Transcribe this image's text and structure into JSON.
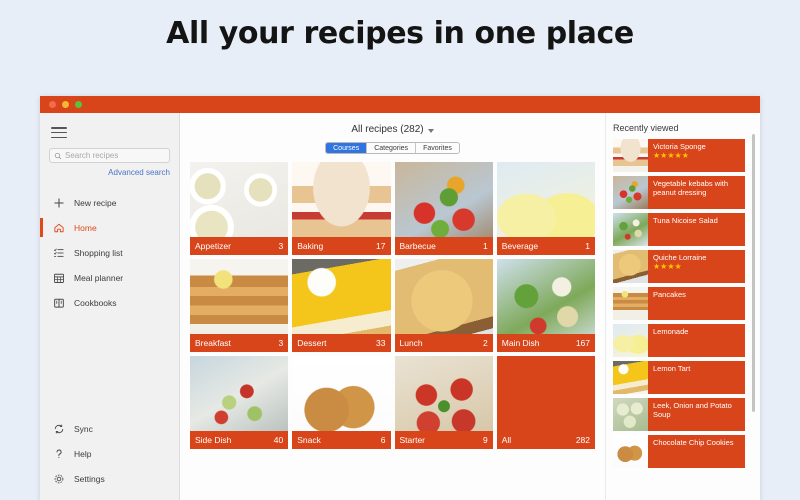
{
  "headline": "All your recipes in one place",
  "window": {
    "traffic_lights": [
      "close",
      "minimize",
      "maximize"
    ]
  },
  "sidebar": {
    "menu_icon": "hamburger-icon",
    "search": {
      "placeholder": "Search recipes",
      "value": "",
      "icon": "search-icon"
    },
    "advanced_search": "Advanced search",
    "items": [
      {
        "label": "New recipe",
        "icon": "plus-icon",
        "active": false
      },
      {
        "label": "Home",
        "icon": "home-icon",
        "active": true
      },
      {
        "label": "Shopping list",
        "icon": "list-icon",
        "active": false
      },
      {
        "label": "Meal planner",
        "icon": "calendar-icon",
        "active": false
      },
      {
        "label": "Cookbooks",
        "icon": "book-icon",
        "active": false
      }
    ],
    "bottom_items": [
      {
        "label": "Sync",
        "icon": "sync-icon"
      },
      {
        "label": "Help",
        "icon": "question-icon"
      },
      {
        "label": "Settings",
        "icon": "gear-icon"
      }
    ]
  },
  "main": {
    "title": "All recipes (282)",
    "title_chevron": "chevron-down-icon",
    "segments": [
      {
        "label": "Courses",
        "selected": true
      },
      {
        "label": "Categories",
        "selected": false
      },
      {
        "label": "Favorites",
        "selected": false
      }
    ],
    "tiles": [
      {
        "label": "Appetizer",
        "count": "3",
        "photo": "ph-soup"
      },
      {
        "label": "Baking",
        "count": "17",
        "photo": "ph-cake"
      },
      {
        "label": "Barbecue",
        "count": "1",
        "photo": "ph-bbq"
      },
      {
        "label": "Beverage",
        "count": "1",
        "photo": "ph-lemonade"
      },
      {
        "label": "Breakfast",
        "count": "3",
        "photo": "ph-pancake"
      },
      {
        "label": "Dessert",
        "count": "33",
        "photo": "ph-tart"
      },
      {
        "label": "Lunch",
        "count": "2",
        "photo": "ph-quiche"
      },
      {
        "label": "Main Dish",
        "count": "167",
        "photo": "ph-salad"
      },
      {
        "label": "Side Dish",
        "count": "40",
        "photo": "ph-sidedish"
      },
      {
        "label": "Snack",
        "count": "6",
        "photo": "ph-cookie"
      },
      {
        "label": "Starter",
        "count": "9",
        "photo": "ph-starter"
      },
      {
        "label": "All",
        "count": "282",
        "photo": "ph-plain"
      }
    ]
  },
  "recently_viewed": {
    "title": "Recently viewed",
    "items": [
      {
        "name": "Victoria Sponge",
        "stars": "★★★★★",
        "photo": "ph-cake"
      },
      {
        "name": "Vegetable kebabs with peanut dressing",
        "stars": "",
        "photo": "ph-bbq"
      },
      {
        "name": "Tuna Nicoise Salad",
        "stars": "",
        "photo": "ph-salad"
      },
      {
        "name": "Quiche Lorraine",
        "stars": "★★★★",
        "photo": "ph-quiche"
      },
      {
        "name": "Pancakes",
        "stars": "",
        "photo": "ph-pancake"
      },
      {
        "name": "Lemonade",
        "stars": "",
        "photo": "ph-lemonade"
      },
      {
        "name": "Lemon Tart",
        "stars": "",
        "photo": "ph-tart"
      },
      {
        "name": "Leek, Onion and Potato Soup",
        "stars": "",
        "photo": "ph-leek"
      },
      {
        "name": "Chocolate Chip Cookies",
        "stars": "",
        "photo": "ph-cookie"
      }
    ]
  },
  "colors": {
    "brand": "#d9451a",
    "accent_link": "#4a76c4",
    "segment_selected": "#2f74e0",
    "star": "#ffc400",
    "page_background": "#e8eef7"
  }
}
